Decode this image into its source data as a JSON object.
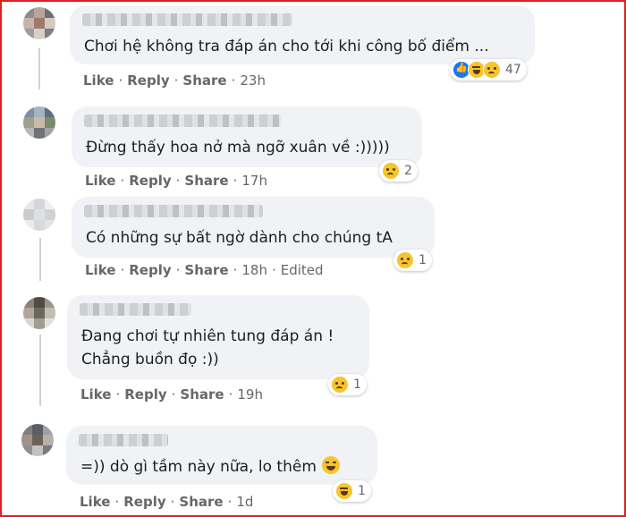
{
  "comments": [
    {
      "text_lines": [
        "Chơi hệ không tra đáp án cho tới khi công bố điểm ..."
      ],
      "actions": {
        "like": "Like",
        "reply": "Reply",
        "share": "Share",
        "time": "23h"
      },
      "reactions": [
        "like-icon",
        "haha-icon",
        "sad-icon"
      ],
      "reaction_count": "47"
    },
    {
      "text_lines": [
        "Đừng thấy hoa nở mà ngỡ xuân về :)))))"
      ],
      "actions": {
        "like": "Like",
        "reply": "Reply",
        "share": "Share",
        "time": "17h"
      },
      "reactions": [
        "sad-icon"
      ],
      "reaction_count": "2"
    },
    {
      "text_lines": [
        "Có những sự bất ngờ dành cho chúng tA"
      ],
      "actions": {
        "like": "Like",
        "reply": "Reply",
        "share": "Share",
        "time": "18h",
        "edited": "Edited"
      },
      "reactions": [
        "sad-icon"
      ],
      "reaction_count": "1"
    },
    {
      "text_lines": [
        "Đang chơi tự nhiên tung đáp án !",
        "Chẳng buồn đọ :))"
      ],
      "actions": {
        "like": "Like",
        "reply": "Reply",
        "share": "Share",
        "time": "19h"
      },
      "reactions": [
        "sad-icon"
      ],
      "reaction_count": "1"
    },
    {
      "text_lines": [
        "=)) dò gì tầm này nữa, lo thêm"
      ],
      "inline_emoji": "tired-face-icon",
      "actions": {
        "like": "Like",
        "reply": "Reply",
        "share": "Share",
        "time": "1d"
      },
      "reactions": [
        "haha-icon"
      ],
      "reaction_count": "1"
    }
  ],
  "colors": {
    "frame": "#e02020",
    "bubble": "#f0f2f5",
    "action_text": "#65676b",
    "like_blue": "#1877f2",
    "emoji_yellow": "#f7c42e"
  }
}
